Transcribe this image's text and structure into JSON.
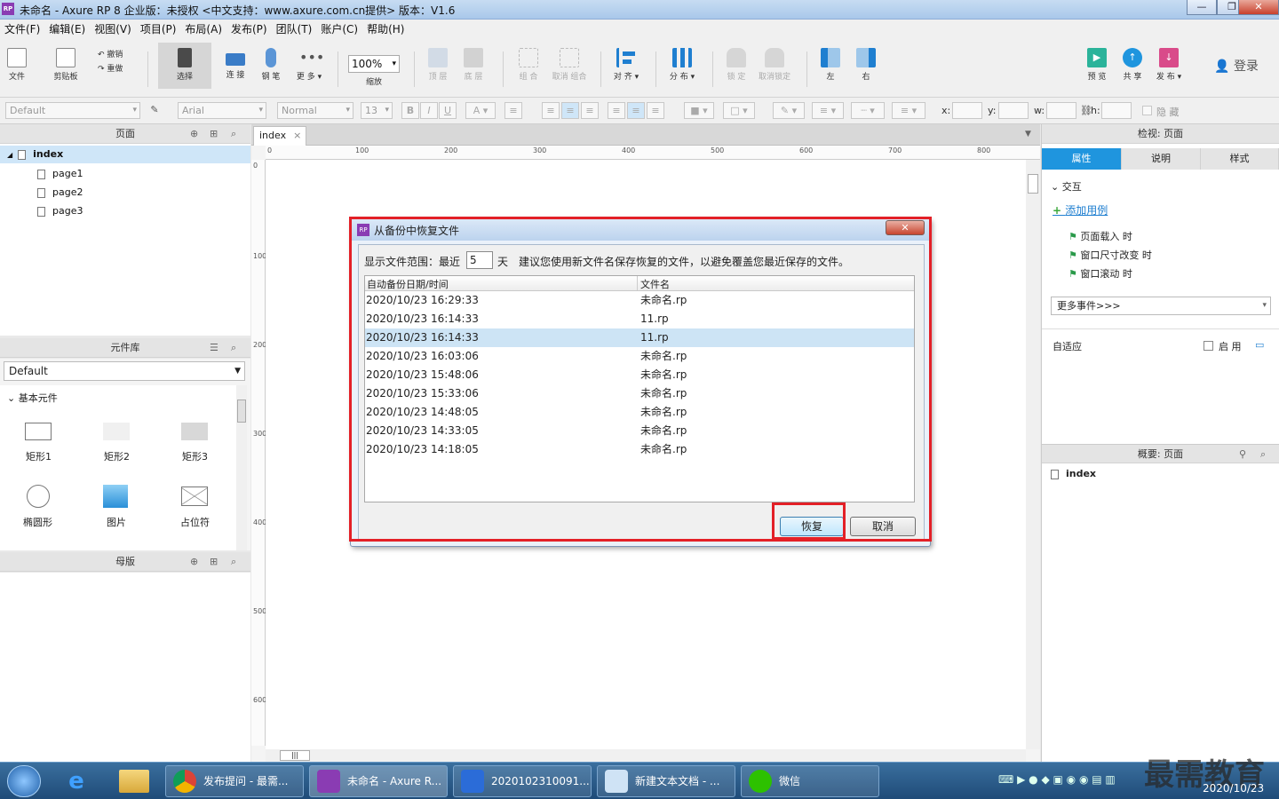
{
  "window": {
    "title": "未命名 - Axure RP 8 企业版：未授权      <中文支持：www.axure.com.cn提供> 版本：V1.6",
    "min": "—",
    "max": "❐",
    "close": "✕"
  },
  "menu": [
    "文件(F)",
    "编辑(E)",
    "视图(V)",
    "项目(P)",
    "布局(A)",
    "发布(P)",
    "团队(T)",
    "账户(C)",
    "帮助(H)"
  ],
  "toolbar": {
    "file": "文件",
    "clipboard": "剪贴板",
    "undo": "撤销",
    "redo": "重做",
    "select": "选择",
    "connect": "连 接",
    "pen": "钢 笔",
    "more": "更 多 ▾",
    "zoom_value": "100%",
    "zoom": "缩放",
    "top": "顶 层",
    "bottom": "底 层",
    "group": "组 合",
    "ungroup": "取消 组合",
    "align": "对 齐 ▾",
    "distribute": "分 布 ▾",
    "lock": "锁 定",
    "unlock": "取消锁定",
    "left": "左",
    "right": "右",
    "preview": "预 览",
    "share": "共 享",
    "publish": "发 布 ▾",
    "login": "登录"
  },
  "format": {
    "style": "Default",
    "font": "Arial",
    "weight": "Normal",
    "size": "13",
    "x": "x:",
    "y": "y:",
    "w": "w:",
    "h": "h:",
    "hide": "隐 藏"
  },
  "pages_panel": {
    "title": "页面",
    "root": "index",
    "children": [
      "page1",
      "page2",
      "page3"
    ]
  },
  "library_panel": {
    "title": "元件库",
    "library": "Default",
    "group": "基本元件",
    "widgets": [
      "矩形1",
      "矩形2",
      "矩形3",
      "椭圆形",
      "图片",
      "占位符"
    ]
  },
  "masters_panel": {
    "title": "母版"
  },
  "canvas": {
    "tab": "index",
    "ruler_h": [
      "0",
      "100",
      "200",
      "300",
      "400",
      "500",
      "600",
      "700",
      "800"
    ],
    "ruler_v": [
      "0",
      "100",
      "200",
      "300",
      "400",
      "500",
      "600"
    ]
  },
  "inspector": {
    "title": "检视: 页面",
    "tabs": [
      "属性",
      "说明",
      "样式"
    ],
    "interactions": "交互",
    "add_case": "添加用例",
    "events": [
      "页面载入 时",
      "窗口尺寸改变 时",
      "窗口滚动 时"
    ],
    "more_events": "更多事件>>>",
    "adaptive": "自适应",
    "enable": "启 用"
  },
  "outline": {
    "title": "概要: 页面",
    "item": "index"
  },
  "dialog": {
    "title": "从备份中恢复文件",
    "range_label": "显示文件范围：最近",
    "days_value": "5",
    "days_unit": "天",
    "hint": "建议您使用新文件名保存恢复的文件，以避免覆盖您最近保存的文件。",
    "col_date": "自动备份日期/时间",
    "col_name": "文件名",
    "rows": [
      {
        "date": "2020/10/23 16:29:33",
        "name": "未命名.rp"
      },
      {
        "date": "2020/10/23 16:14:33",
        "name": "11.rp"
      },
      {
        "date": "2020/10/23 16:14:33",
        "name": "11.rp"
      },
      {
        "date": "2020/10/23 16:03:06",
        "name": "未命名.rp"
      },
      {
        "date": "2020/10/23 15:48:06",
        "name": "未命名.rp"
      },
      {
        "date": "2020/10/23 15:33:06",
        "name": "未命名.rp"
      },
      {
        "date": "2020/10/23 14:48:05",
        "name": "未命名.rp"
      },
      {
        "date": "2020/10/23 14:33:05",
        "name": "未命名.rp"
      },
      {
        "date": "2020/10/23 14:18:05",
        "name": "未命名.rp"
      }
    ],
    "restore": "恢复",
    "cancel": "取消"
  },
  "taskbar": {
    "tasks": [
      "发布提问 - 最需...",
      "未命名 - Axure R...",
      "2020102310091...",
      "新建文本文档 - ...",
      "微信"
    ],
    "watermark": "最需教育",
    "date": "2020/10/23"
  },
  "colors": {
    "accent": "#1f95de",
    "highlight": "#e32027",
    "selected_row": "#cde4f5"
  }
}
